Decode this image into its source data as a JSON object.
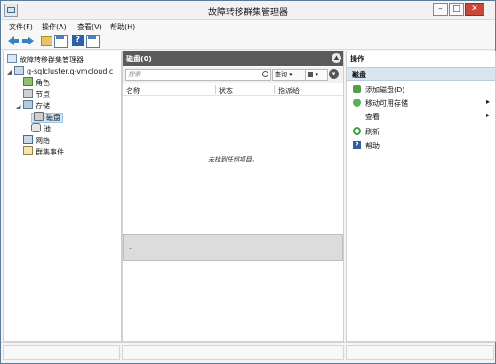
{
  "window": {
    "title": "故障转移群集管理器",
    "minimize_glyph": "–",
    "maximize_glyph": "□",
    "close_glyph": "✕"
  },
  "menu": [
    "文件(F)",
    "操作(A)",
    "查看(V)",
    "帮助(H)"
  ],
  "toolbar": {
    "icons": [
      "back-icon",
      "forward-icon",
      "folder-icon",
      "console-tree-icon",
      "help-icon",
      "action-pane-icon"
    ]
  },
  "tree": {
    "root": "故障转移群集管理器",
    "cluster": "q-sqlcluster.q-vmcloud.c",
    "roles": "角色",
    "nodes": "节点",
    "storage": "存储",
    "disks": "磁盘",
    "pools": "池",
    "networks": "网络",
    "events": "群集事件"
  },
  "center": {
    "header": "磁盘(0)",
    "search_placeholder": "搜索",
    "query_label": "查询",
    "save_glyph": "▾",
    "columns": [
      "名称",
      "状态",
      "指派给"
    ],
    "empty_message": "未找到任何项目。",
    "detail_toggle": "⌄"
  },
  "actions": {
    "title": "操作",
    "section": "磁盘",
    "items": [
      {
        "label": "添加磁盘(D)",
        "icon": "add-disk-icon",
        "submenu": false
      },
      {
        "label": "移动可用存储",
        "icon": "move-storage-icon",
        "submenu": true
      },
      {
        "label": "查看",
        "icon": "",
        "submenu": true
      },
      {
        "label": "刷新",
        "icon": "refresh-icon",
        "submenu": false
      },
      {
        "label": "帮助",
        "icon": "help-icon",
        "submenu": false
      }
    ]
  },
  "colors": {
    "header_dark": "#5a5a5a",
    "section_highlight": "#d8e6f2",
    "accent_blue": "#3b7fc4"
  }
}
